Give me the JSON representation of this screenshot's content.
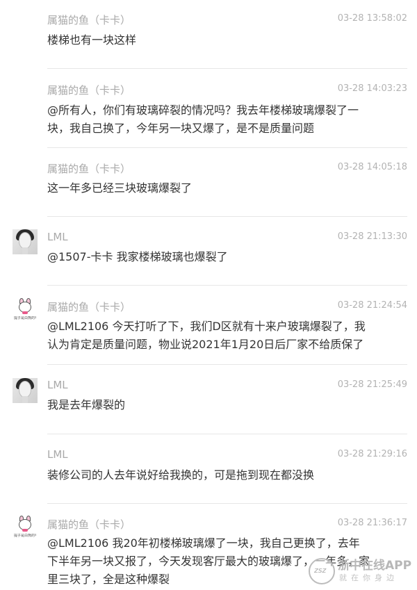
{
  "messages": [
    {
      "name": "属猫的鱼（卡卡）",
      "time": "03-28 13:58:02",
      "avatar": "none",
      "lines": [
        "楼梯也有一块这样"
      ]
    },
    {
      "name": "属猫的鱼（卡卡）",
      "time": "03-28 14:03:23",
      "avatar": "none",
      "lines": [
        "@所有人，你们有玻璃碎裂的情况吗？我去年楼梯玻璃爆裂了一",
        "块，我自己换了，今年另一块又爆了，是不是质量问题"
      ]
    },
    {
      "name": "属猫的鱼（卡卡）",
      "time": "03-28 14:05:18",
      "avatar": "none",
      "lines": [
        "这一年多已经三块玻璃爆裂了"
      ]
    },
    {
      "name": "LML",
      "time": "03-28 21:13:30",
      "avatar": "photo",
      "lines": [
        "@1507-卡卡 我家楼梯玻璃也爆裂了"
      ]
    },
    {
      "name": "属猫的鱼（卡卡）",
      "time": "03-28 21:24:54",
      "avatar": "cartoon",
      "lines": [
        "@LML2106 今天打听了下，我们D区就有十来户玻璃爆裂了，我",
        "认为肯定是质量问题，物业说2021年1月20日后厂家不给质保了"
      ]
    },
    {
      "name": "LML",
      "time": "03-28 21:25:49",
      "avatar": "photo",
      "lines": [
        "我是去年爆裂的"
      ]
    },
    {
      "name": "LML",
      "time": "03-28 21:29:16",
      "avatar": "none",
      "lines": [
        "装修公司的人去年说好给我换的，可是拖到现在都没换"
      ]
    },
    {
      "name": "属猫的鱼（卡卡）",
      "time": "03-28 21:36:17",
      "avatar": "cartoon",
      "lines": [
        "@LML2106 我20年初楼梯玻璃爆了一块，我自己更换了，去年",
        "下半年另一块又报了，今天发现客厅最大的玻璃爆了，一年多，家",
        "里三块了，全是这种爆裂"
      ]
    }
  ],
  "avatar_caption": "提子是白熊的可能",
  "watermark": {
    "title": "浙中在线APP",
    "subtitle": "就在你身边",
    "logo_text": "zsz"
  }
}
